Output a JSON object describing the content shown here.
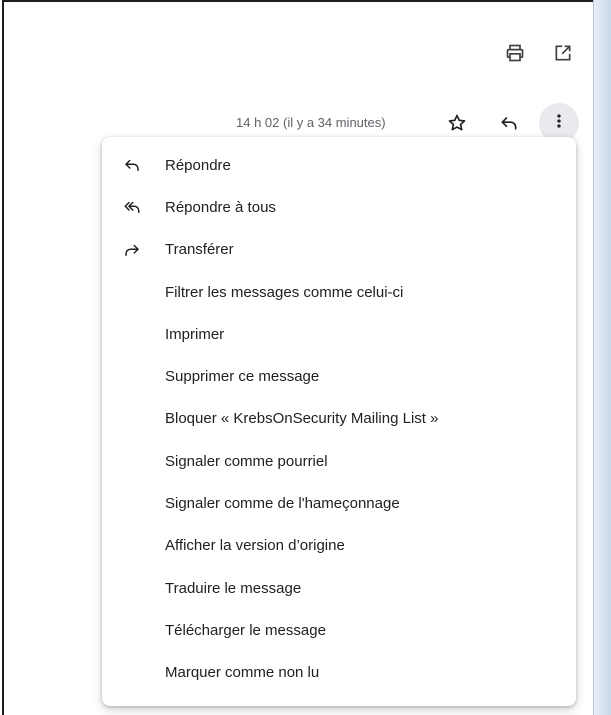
{
  "toolbar": {
    "print_icon": "print-icon",
    "open_new_window_icon": "open-in-new-window-icon"
  },
  "message_header": {
    "timestamp": "14 h 02 (il y a 34 minutes)",
    "star_icon": "star-icon",
    "reply_icon": "reply-icon",
    "more_icon": "more-vert-icon"
  },
  "menu": {
    "items": [
      {
        "label": "Répondre",
        "icon": "reply-icon"
      },
      {
        "label": "Répondre à tous",
        "icon": "reply-all-icon"
      },
      {
        "label": "Transférer",
        "icon": "forward-icon"
      },
      {
        "label": "Filtrer les messages comme celui-ci",
        "icon": ""
      },
      {
        "label": "Imprimer",
        "icon": ""
      },
      {
        "label": "Supprimer ce message",
        "icon": ""
      },
      {
        "label": "Bloquer « KrebsOnSecurity Mailing List »",
        "icon": ""
      },
      {
        "label": "Signaler comme pourriel",
        "icon": ""
      },
      {
        "label": "Signaler comme de l'hameçonnage",
        "icon": ""
      },
      {
        "label": "Afficher la version d’origine",
        "icon": ""
      },
      {
        "label": "Traduire le message",
        "icon": ""
      },
      {
        "label": "Télécharger le message",
        "icon": ""
      },
      {
        "label": "Marquer comme non lu",
        "icon": ""
      }
    ]
  },
  "colors": {
    "text": "#202124",
    "secondary_text": "#5f6368",
    "more_button_bg": "#e8eaed"
  }
}
